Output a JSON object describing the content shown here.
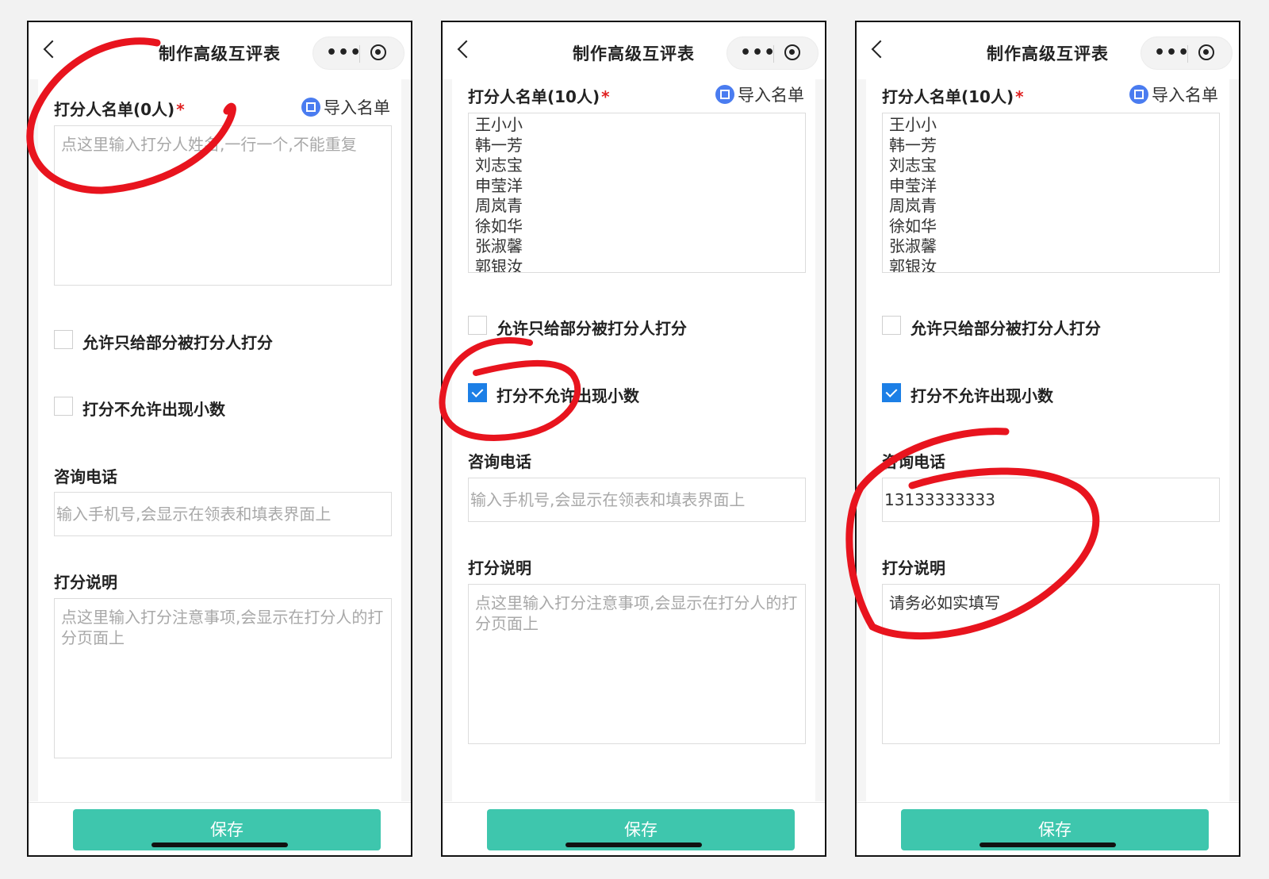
{
  "nav": {
    "title": "制作高级互评表",
    "more": "•••"
  },
  "form": {
    "raters_label_empty": "打分人名单(0人)",
    "raters_label_filled": "打分人名单(10人)",
    "required_mark": "*",
    "import_label": "导入名单",
    "raters_placeholder": "点这里输入打分人姓名,一行一个,不能重复",
    "raters": [
      "王小小",
      "韩一芳",
      "刘志宝",
      "申莹洋",
      "周岚青",
      "徐如华",
      "张淑馨",
      "郭银汝"
    ],
    "option_partial": "允许只给部分被打分人打分",
    "option_no_decimal": "打分不允许出现小数",
    "phone_label": "咨询电话",
    "phone_placeholder": "输入手机号,会显示在领表和填表界面上",
    "phone_value": "13133333333",
    "desc_label": "打分说明",
    "desc_placeholder": "点这里输入打分注意事项,会显示在打分人的打分页面上",
    "desc_value": "请务必如实填写",
    "save_label": "保存"
  },
  "screens": [
    {
      "no_decimal_checked": false
    },
    {
      "no_decimal_checked": true
    },
    {
      "no_decimal_checked": true
    }
  ],
  "colors": {
    "accent": "#3ec6ad",
    "checkbox": "#1c7fe6",
    "annotation": "#e8141e",
    "required": "#e02020"
  }
}
